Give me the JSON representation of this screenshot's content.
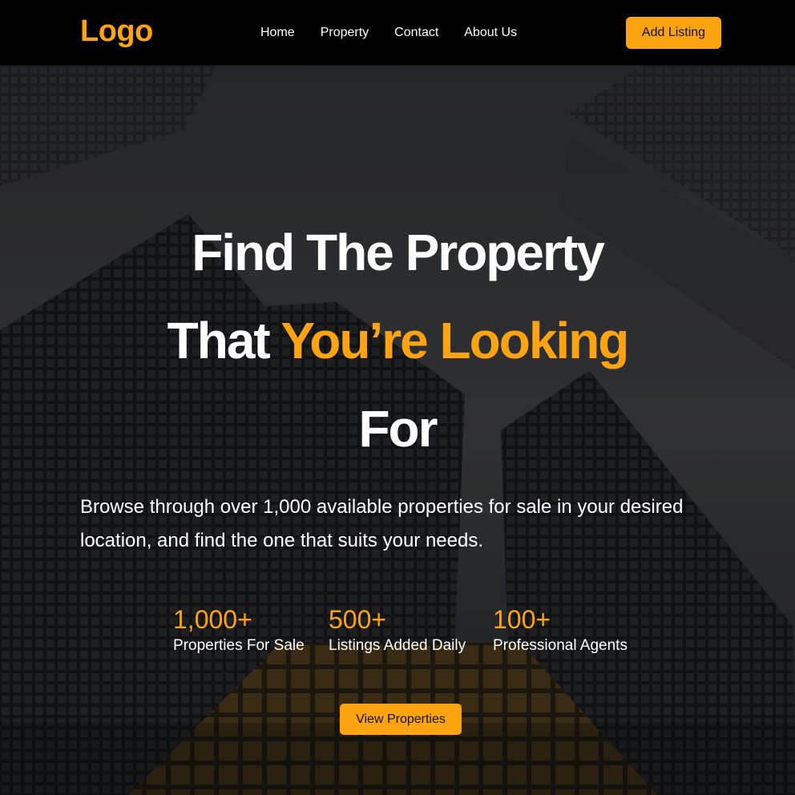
{
  "navbar": {
    "logo": "Logo",
    "links": [
      "Home",
      "Property",
      "Contact",
      "About Us"
    ],
    "cta_label": "Add Listing"
  },
  "hero": {
    "headline_line1": "Find The Property",
    "headline_line2_a": "That ",
    "headline_line2_b": "You’re Looking",
    "headline_line3": "For",
    "subtext": "Browse through over 1,000 available properties for sale in your desired location, and find the one that suits your needs.",
    "stats": [
      {
        "value": "1,000+",
        "label": "Properties For Sale"
      },
      {
        "value": "500+",
        "label": "Listings Added Daily"
      },
      {
        "value": "100+",
        "label": "Professional Agents"
      }
    ],
    "cta_label": "View Properties"
  },
  "colors": {
    "accent": "#fca311",
    "navbar_bg": "#000000",
    "text": "#ffffff"
  }
}
